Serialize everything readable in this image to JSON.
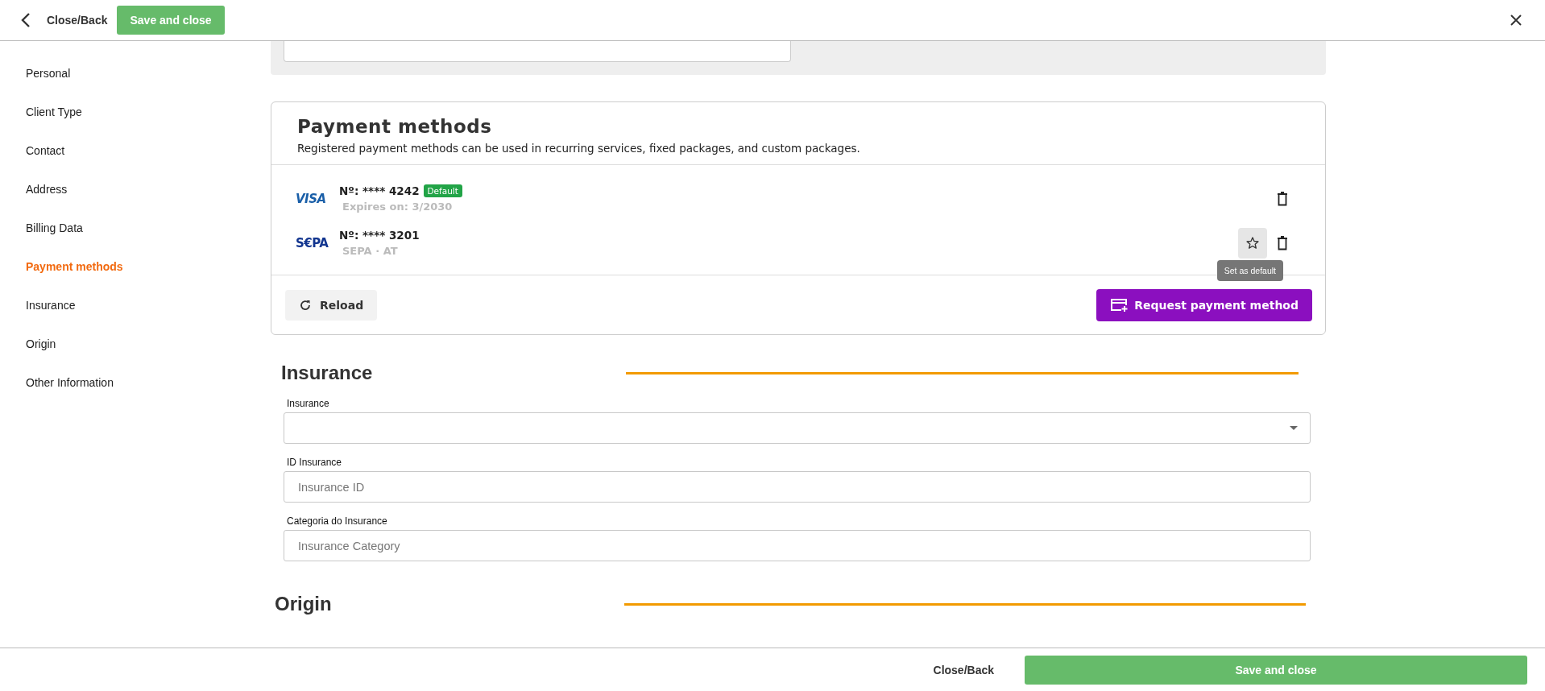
{
  "header": {
    "back_label": "Close/Back",
    "save_label": "Save and close"
  },
  "sidebar": {
    "items": [
      {
        "label": "Personal",
        "selected": false
      },
      {
        "label": "Client Type",
        "selected": false
      },
      {
        "label": "Contact",
        "selected": false
      },
      {
        "label": "Address",
        "selected": false
      },
      {
        "label": "Billing Data",
        "selected": false
      },
      {
        "label": "Payment methods",
        "selected": true
      },
      {
        "label": "Insurance",
        "selected": false
      },
      {
        "label": "Origin",
        "selected": false
      },
      {
        "label": "Other Information",
        "selected": false
      }
    ]
  },
  "payment_methods": {
    "title": "Payment methods",
    "description": "Registered payment methods can be used in recurring services, fixed packages, and custom packages.",
    "methods": [
      {
        "kind": "visa",
        "logo": "VISA",
        "number": "Nº: **** 4242",
        "default": true,
        "default_badge": "Default",
        "detail": "Expires on: 3/2030"
      },
      {
        "kind": "sepa",
        "logo": "S€PA",
        "number": "Nº: **** 3201",
        "default": false,
        "detail": "SEPA · AT",
        "tooltip": "Set as default"
      }
    ],
    "reload_label": "Reload",
    "request_label": "Request payment method"
  },
  "insurance": {
    "title": "Insurance",
    "fields": [
      {
        "kind": "select",
        "label": "Insurance"
      },
      {
        "kind": "text",
        "label": "ID Insurance",
        "placeholder": "Insurance ID"
      },
      {
        "kind": "text",
        "label": "Categoria do Insurance",
        "placeholder": "Insurance Category"
      }
    ]
  },
  "origin": {
    "title": "Origin"
  },
  "footer": {
    "close_label": "Close/Back",
    "save_label": "Save and close"
  }
}
